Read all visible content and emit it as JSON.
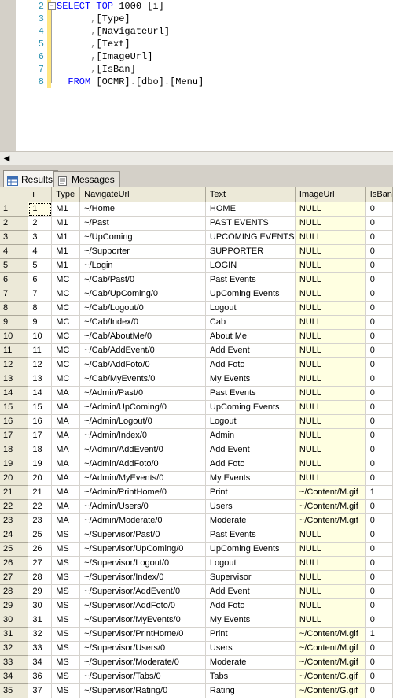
{
  "editor": {
    "line_numbers": [
      "2",
      "3",
      "4",
      "5",
      "6",
      "7",
      "8"
    ],
    "lines": [
      [
        {
          "t": "SELECT TOP ",
          "c": "kw"
        },
        {
          "t": "1000 [i]",
          "c": ""
        }
      ],
      [
        {
          "t": "      ,",
          "c": "gr"
        },
        {
          "t": "[Type]",
          "c": ""
        }
      ],
      [
        {
          "t": "      ,",
          "c": "gr"
        },
        {
          "t": "[NavigateUrl]",
          "c": ""
        }
      ],
      [
        {
          "t": "      ,",
          "c": "gr"
        },
        {
          "t": "[Text]",
          "c": ""
        }
      ],
      [
        {
          "t": "      ,",
          "c": "gr"
        },
        {
          "t": "[ImageUrl]",
          "c": ""
        }
      ],
      [
        {
          "t": "      ,",
          "c": "gr"
        },
        {
          "t": "[IsBan]",
          "c": ""
        }
      ],
      [
        {
          "t": "  FROM ",
          "c": "kw"
        },
        {
          "t": "[OCMR]",
          "c": ""
        },
        {
          "t": ".",
          "c": "gr"
        },
        {
          "t": "[dbo]",
          "c": ""
        },
        {
          "t": ".",
          "c": "gr"
        },
        {
          "t": "[Menu]",
          "c": ""
        }
      ]
    ]
  },
  "tabs": [
    {
      "label": "Results",
      "icon": "grid-icon",
      "active": true
    },
    {
      "label": "Messages",
      "icon": "messages-icon",
      "active": false
    }
  ],
  "grid": {
    "columns": [
      "i",
      "Type",
      "NavigateUrl",
      "Text",
      "ImageUrl",
      "IsBan"
    ],
    "rows": [
      [
        "1",
        "1",
        "M1",
        "~/Home",
        "HOME",
        "NULL",
        "0"
      ],
      [
        "2",
        "2",
        "M1",
        "~/Past",
        "PAST EVENTS",
        "NULL",
        "0"
      ],
      [
        "3",
        "3",
        "M1",
        "~/UpComing",
        "UPCOMING EVENTS",
        "NULL",
        "0"
      ],
      [
        "4",
        "4",
        "M1",
        "~/Supporter",
        "SUPPORTER",
        "NULL",
        "0"
      ],
      [
        "5",
        "5",
        "M1",
        "~/Login",
        "LOGIN",
        "NULL",
        "0"
      ],
      [
        "6",
        "6",
        "MC",
        "~/Cab/Past/0",
        "Past Events",
        "NULL",
        "0"
      ],
      [
        "7",
        "7",
        "MC",
        "~/Cab/UpComing/0",
        "UpComing Events",
        "NULL",
        "0"
      ],
      [
        "8",
        "8",
        "MC",
        "~/Cab/Logout/0",
        "Logout",
        "NULL",
        "0"
      ],
      [
        "9",
        "9",
        "MC",
        "~/Cab/Index/0",
        "Cab",
        "NULL",
        "0"
      ],
      [
        "10",
        "10",
        "MC",
        "~/Cab/AboutMe/0",
        "About Me",
        "NULL",
        "0"
      ],
      [
        "11",
        "11",
        "MC",
        "~/Cab/AddEvent/0",
        "Add Event",
        "NULL",
        "0"
      ],
      [
        "12",
        "12",
        "MC",
        "~/Cab/AddFoto/0",
        "Add Foto",
        "NULL",
        "0"
      ],
      [
        "13",
        "13",
        "MC",
        "~/Cab/MyEvents/0",
        "My Events",
        "NULL",
        "0"
      ],
      [
        "14",
        "14",
        "MA",
        "~/Admin/Past/0",
        "Past Events",
        "NULL",
        "0"
      ],
      [
        "15",
        "15",
        "MA",
        "~/Admin/UpComing/0",
        "UpComing Events",
        "NULL",
        "0"
      ],
      [
        "16",
        "16",
        "MA",
        "~/Admin/Logout/0",
        "Logout",
        "NULL",
        "0"
      ],
      [
        "17",
        "17",
        "MA",
        "~/Admin/Index/0",
        "Admin",
        "NULL",
        "0"
      ],
      [
        "18",
        "18",
        "MA",
        "~/Admin/AddEvent/0",
        "Add Event",
        "NULL",
        "0"
      ],
      [
        "19",
        "19",
        "MA",
        "~/Admin/AddFoto/0",
        "Add Foto",
        "NULL",
        "0"
      ],
      [
        "20",
        "20",
        "MA",
        "~/Admin/MyEvents/0",
        "My Events",
        "NULL",
        "0"
      ],
      [
        "21",
        "21",
        "MA",
        "~/Admin/PrintHome/0",
        "Print",
        "~/Content/M.gif",
        "1"
      ],
      [
        "22",
        "22",
        "MA",
        "~/Admin/Users/0",
        "Users",
        "~/Content/M.gif",
        "0"
      ],
      [
        "23",
        "23",
        "MA",
        "~/Admin/Moderate/0",
        "Moderate",
        "~/Content/M.gif",
        "0"
      ],
      [
        "24",
        "25",
        "MS",
        "~/Supervisor/Past/0",
        "Past Events",
        "NULL",
        "0"
      ],
      [
        "25",
        "26",
        "MS",
        "~/Supervisor/UpComing/0",
        "UpComing Events",
        "NULL",
        "0"
      ],
      [
        "26",
        "27",
        "MS",
        "~/Supervisor/Logout/0",
        "Logout",
        "NULL",
        "0"
      ],
      [
        "27",
        "28",
        "MS",
        "~/Supervisor/Index/0",
        "Supervisor",
        "NULL",
        "0"
      ],
      [
        "28",
        "29",
        "MS",
        "~/Supervisor/AddEvent/0",
        "Add Event",
        "NULL",
        "0"
      ],
      [
        "29",
        "30",
        "MS",
        "~/Supervisor/AddFoto/0",
        "Add Foto",
        "NULL",
        "0"
      ],
      [
        "30",
        "31",
        "MS",
        "~/Supervisor/MyEvents/0",
        "My Events",
        "NULL",
        "0"
      ],
      [
        "31",
        "32",
        "MS",
        "~/Supervisor/PrintHome/0",
        "Print",
        "~/Content/M.gif",
        "1"
      ],
      [
        "32",
        "33",
        "MS",
        "~/Supervisor/Users/0",
        "Users",
        "~/Content/M.gif",
        "0"
      ],
      [
        "33",
        "34",
        "MS",
        "~/Supervisor/Moderate/0",
        "Moderate",
        "~/Content/M.gif",
        "0"
      ],
      [
        "34",
        "36",
        "MS",
        "~/Supervisor/Tabs/0",
        "Tabs",
        "~/Content/G.gif",
        "0"
      ],
      [
        "35",
        "37",
        "MS",
        "~/Supervisor/Rating/0",
        "Rating",
        "~/Content/G.gif",
        "0"
      ]
    ]
  },
  "colors": {
    "keyword": "#0000ff",
    "null_cell": "#ffffe1",
    "header": "#ece9d8"
  }
}
